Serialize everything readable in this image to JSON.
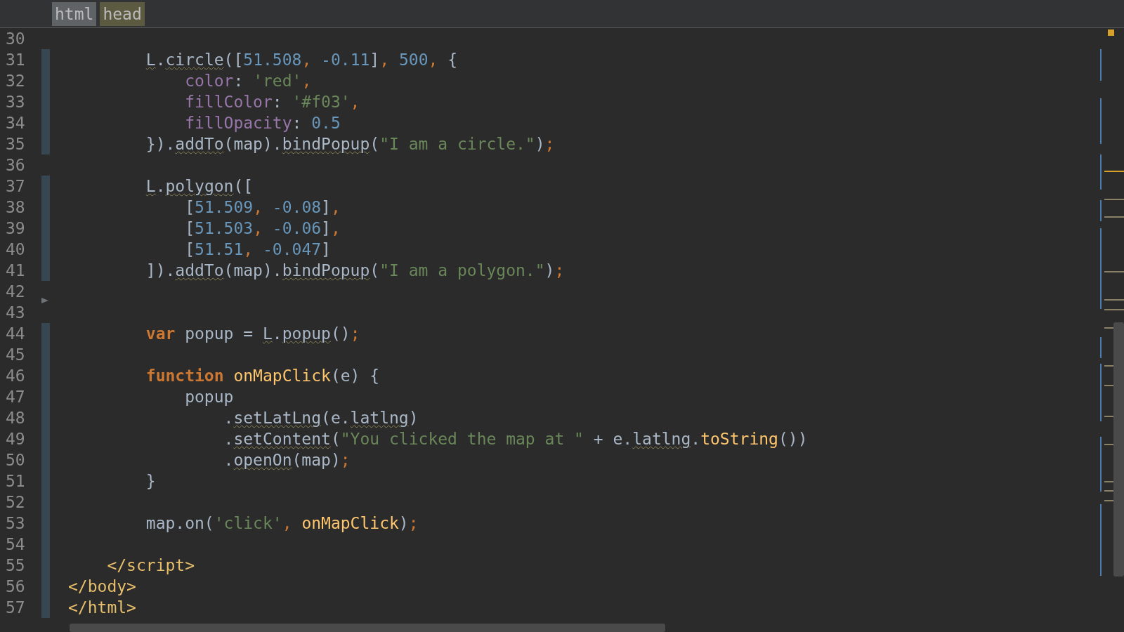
{
  "breadcrumbs": [
    {
      "label": "html",
      "selected": false
    },
    {
      "label": "head",
      "selected": true
    }
  ],
  "lines": [
    {
      "number": "30",
      "changed": false,
      "fold": false
    },
    {
      "number": "31",
      "changed": true,
      "fold": false,
      "tokens": [
        {
          "text": "        L",
          "kind": "plain",
          "warn": true
        },
        {
          "text": ".",
          "kind": "plain",
          "warn": false
        },
        {
          "text": "circle",
          "kind": "plain",
          "warn": true
        },
        {
          "text": "([",
          "kind": "plain",
          "warn": false
        },
        {
          "text": "51.508",
          "kind": "number",
          "warn": false
        },
        {
          "text": ",",
          "kind": "punct",
          "warn": false
        },
        {
          "text": " -0.11",
          "kind": "number",
          "warn": false
        },
        {
          "text": "]",
          "kind": "plain",
          "warn": false
        },
        {
          "text": ",",
          "kind": "punct",
          "warn": false
        },
        {
          "text": " 500",
          "kind": "number",
          "warn": false
        },
        {
          "text": ",",
          "kind": "punct",
          "warn": false
        },
        {
          "text": " {",
          "kind": "plain",
          "warn": false
        }
      ]
    },
    {
      "number": "32",
      "changed": true,
      "fold": false,
      "tokens": [
        {
          "text": "            color",
          "kind": "property",
          "warn": false
        },
        {
          "text": ":",
          "kind": "plain",
          "warn": false
        },
        {
          "text": " 'red'",
          "kind": "string",
          "warn": false
        },
        {
          "text": ",",
          "kind": "punct",
          "warn": false
        }
      ]
    },
    {
      "number": "33",
      "changed": true,
      "fold": false,
      "tokens": [
        {
          "text": "            fillColor",
          "kind": "property",
          "warn": false
        },
        {
          "text": ":",
          "kind": "plain",
          "warn": false
        },
        {
          "text": " '#f03'",
          "kind": "string",
          "warn": false
        },
        {
          "text": ",",
          "kind": "punct",
          "warn": false
        }
      ]
    },
    {
      "number": "34",
      "changed": true,
      "fold": false,
      "tokens": [
        {
          "text": "            fillOpacity",
          "kind": "property",
          "warn": false
        },
        {
          "text": ":",
          "kind": "plain",
          "warn": false
        },
        {
          "text": " 0.5",
          "kind": "number",
          "warn": false
        }
      ]
    },
    {
      "number": "35",
      "changed": true,
      "fold": false,
      "tokens": [
        {
          "text": "        }).",
          "kind": "plain",
          "warn": false
        },
        {
          "text": "addTo",
          "kind": "plain",
          "warn": true
        },
        {
          "text": "(map).",
          "kind": "plain",
          "warn": false
        },
        {
          "text": "bindPopup",
          "kind": "plain",
          "warn": true
        },
        {
          "text": "(",
          "kind": "plain",
          "warn": false
        },
        {
          "text": "\"I am a circle.\"",
          "kind": "string",
          "warn": false
        },
        {
          "text": ")",
          "kind": "plain",
          "warn": false
        },
        {
          "text": ";",
          "kind": "punct",
          "warn": false
        }
      ]
    },
    {
      "number": "36",
      "changed": false,
      "fold": false
    },
    {
      "number": "37",
      "changed": true,
      "fold": false,
      "tokens": [
        {
          "text": "        L",
          "kind": "plain",
          "warn": true
        },
        {
          "text": ".",
          "kind": "plain",
          "warn": false
        },
        {
          "text": "polygon",
          "kind": "plain",
          "warn": true
        },
        {
          "text": "([",
          "kind": "plain",
          "warn": false
        }
      ]
    },
    {
      "number": "38",
      "changed": true,
      "fold": false,
      "tokens": [
        {
          "text": "            [",
          "kind": "plain",
          "warn": false
        },
        {
          "text": "51.509",
          "kind": "number",
          "warn": false
        },
        {
          "text": ",",
          "kind": "punct",
          "warn": false
        },
        {
          "text": " -0.08",
          "kind": "number",
          "warn": false
        },
        {
          "text": "]",
          "kind": "plain",
          "warn": false
        },
        {
          "text": ",",
          "kind": "punct",
          "warn": false
        }
      ]
    },
    {
      "number": "39",
      "changed": true,
      "fold": false,
      "tokens": [
        {
          "text": "            [",
          "kind": "plain",
          "warn": false
        },
        {
          "text": "51.503",
          "kind": "number",
          "warn": false
        },
        {
          "text": ",",
          "kind": "punct",
          "warn": false
        },
        {
          "text": " -0.06",
          "kind": "number",
          "warn": false
        },
        {
          "text": "]",
          "kind": "plain",
          "warn": false
        },
        {
          "text": ",",
          "kind": "punct",
          "warn": false
        }
      ]
    },
    {
      "number": "40",
      "changed": true,
      "fold": false,
      "tokens": [
        {
          "text": "            [",
          "kind": "plain",
          "warn": false
        },
        {
          "text": "51.51",
          "kind": "number",
          "warn": false
        },
        {
          "text": ",",
          "kind": "punct",
          "warn": false
        },
        {
          "text": " -0.047",
          "kind": "number",
          "warn": false
        },
        {
          "text": "]",
          "kind": "plain",
          "warn": false
        }
      ]
    },
    {
      "number": "41",
      "changed": true,
      "fold": false,
      "tokens": [
        {
          "text": "        ]).",
          "kind": "plain",
          "warn": false
        },
        {
          "text": "addTo",
          "kind": "plain",
          "warn": true
        },
        {
          "text": "(map).",
          "kind": "plain",
          "warn": false
        },
        {
          "text": "bindPopup",
          "kind": "plain",
          "warn": true
        },
        {
          "text": "(",
          "kind": "plain",
          "warn": false
        },
        {
          "text": "\"I am a polygon.\"",
          "kind": "string",
          "warn": false
        },
        {
          "text": ")",
          "kind": "plain",
          "warn": false
        },
        {
          "text": ";",
          "kind": "punct",
          "warn": false
        }
      ]
    },
    {
      "number": "42",
      "changed": false,
      "fold": true
    },
    {
      "number": "43",
      "changed": false,
      "fold": false
    },
    {
      "number": "44",
      "changed": true,
      "fold": false,
      "tokens": [
        {
          "text": "        var",
          "kind": "keyword",
          "warn": false
        },
        {
          "text": " popup =",
          "kind": "plain",
          "warn": false
        },
        {
          "text": " L",
          "kind": "plain",
          "warn": true
        },
        {
          "text": ".",
          "kind": "plain",
          "warn": false
        },
        {
          "text": "popup",
          "kind": "plain",
          "warn": true
        },
        {
          "text": "()",
          "kind": "plain",
          "warn": false
        },
        {
          "text": ";",
          "kind": "punct",
          "warn": false
        }
      ]
    },
    {
      "number": "45",
      "changed": true,
      "fold": false
    },
    {
      "number": "46",
      "changed": true,
      "fold": false,
      "tokens": [
        {
          "text": "        function",
          "kind": "keyword",
          "warn": false
        },
        {
          "text": " onMapClick",
          "kind": "function",
          "warn": false
        },
        {
          "text": "(e) {",
          "kind": "plain",
          "warn": false
        }
      ]
    },
    {
      "number": "47",
      "changed": true,
      "fold": false,
      "tokens": [
        {
          "text": "            popup",
          "kind": "plain",
          "warn": false
        }
      ]
    },
    {
      "number": "48",
      "changed": true,
      "fold": false,
      "tokens": [
        {
          "text": "                .",
          "kind": "plain",
          "warn": false
        },
        {
          "text": "setLatLng",
          "kind": "plain",
          "warn": true
        },
        {
          "text": "(e.",
          "kind": "plain",
          "warn": false
        },
        {
          "text": "latlng",
          "kind": "plain",
          "warn": true
        },
        {
          "text": ")",
          "kind": "plain",
          "warn": false
        }
      ]
    },
    {
      "number": "49",
      "changed": true,
      "fold": false,
      "tokens": [
        {
          "text": "                .",
          "kind": "plain",
          "warn": false
        },
        {
          "text": "setContent",
          "kind": "plain",
          "warn": true
        },
        {
          "text": "(",
          "kind": "plain",
          "warn": false
        },
        {
          "text": "\"You clicked the map at \"",
          "kind": "string",
          "warn": false
        },
        {
          "text": " + e.",
          "kind": "plain",
          "warn": false
        },
        {
          "text": "latlng",
          "kind": "plain",
          "warn": true
        },
        {
          "text": ".",
          "kind": "plain",
          "warn": false
        },
        {
          "text": "toString",
          "kind": "function",
          "warn": false
        },
        {
          "text": "())",
          "kind": "plain",
          "warn": false
        }
      ]
    },
    {
      "number": "50",
      "changed": true,
      "fold": false,
      "tokens": [
        {
          "text": "                .",
          "kind": "plain",
          "warn": false
        },
        {
          "text": "openOn",
          "kind": "plain",
          "warn": true
        },
        {
          "text": "(map)",
          "kind": "plain",
          "warn": false
        },
        {
          "text": ";",
          "kind": "punct",
          "warn": false
        }
      ]
    },
    {
      "number": "51",
      "changed": true,
      "fold": false,
      "tokens": [
        {
          "text": "        }",
          "kind": "plain",
          "warn": false
        }
      ]
    },
    {
      "number": "52",
      "changed": true,
      "fold": false
    },
    {
      "number": "53",
      "changed": true,
      "fold": false,
      "tokens": [
        {
          "text": "        map.on(",
          "kind": "plain",
          "warn": false
        },
        {
          "text": "'click'",
          "kind": "string",
          "warn": false
        },
        {
          "text": ",",
          "kind": "punct",
          "warn": false
        },
        {
          "text": " onMapClick",
          "kind": "function",
          "warn": false
        },
        {
          "text": ")",
          "kind": "plain",
          "warn": false
        },
        {
          "text": ";",
          "kind": "punct",
          "warn": false
        }
      ]
    },
    {
      "number": "54",
      "changed": true,
      "fold": false
    },
    {
      "number": "55",
      "changed": true,
      "fold": false,
      "tokens": [
        {
          "text": "    </script>",
          "kind": "tag",
          "warn": false
        }
      ]
    },
    {
      "number": "56",
      "changed": true,
      "fold": false,
      "tokens": [
        {
          "text": "</body>",
          "kind": "tag",
          "warn": false
        }
      ]
    },
    {
      "number": "57",
      "changed": true,
      "fold": false,
      "tokens": [
        {
          "text": "</html>",
          "kind": "tag",
          "warn": false
        }
      ]
    }
  ]
}
